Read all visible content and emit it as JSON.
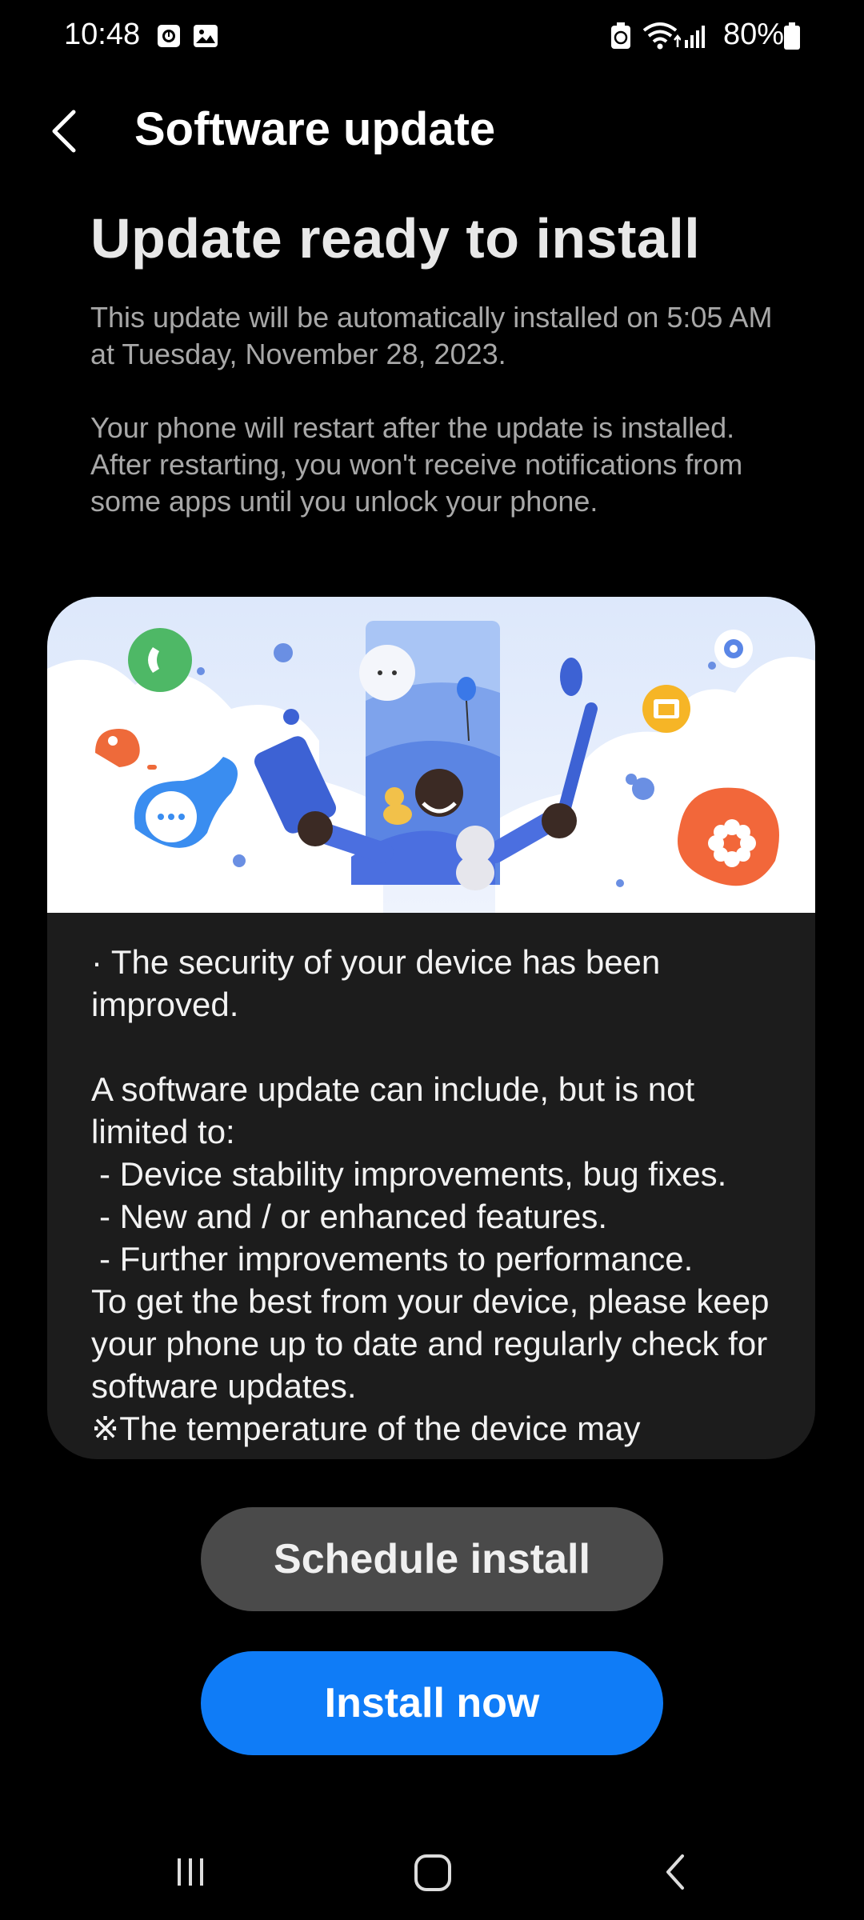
{
  "status_bar": {
    "time": "10:48",
    "battery_percent": "80%",
    "icons": [
      "screen-record-icon",
      "gallery-icon",
      "battery-saver-icon",
      "wifi-icon",
      "signal-icon",
      "battery-icon"
    ]
  },
  "header": {
    "title": "Software update",
    "back_icon": "chevron-left-icon"
  },
  "content": {
    "heading": "Update ready to install",
    "description_1": "This update will be automatically installed on 5:05 AM at Tuesday, November 28, 2023.",
    "description_2": "Your phone will restart after the update is installed. After restarting, you won't receive notifications from some apps until you unlock your phone."
  },
  "card": {
    "lines": [
      "· The security of your device has been improved.",
      "",
      "A software update can include, but is not limited to:",
      " - Device stability improvements, bug fixes.",
      " - New and / or enhanced features.",
      " - Further improvements to performance.",
      "To get the best from your device, please keep your phone up to date and regularly check for software updates.",
      "※The temperature of the device may"
    ]
  },
  "buttons": {
    "schedule": "Schedule install",
    "install": "Install now"
  },
  "navbar": {
    "recents": "recents-icon",
    "home": "home-icon",
    "back": "back-icon"
  },
  "colors": {
    "background": "#000000",
    "install_button": "#0f7cf7",
    "schedule_button": "#4a4a4a",
    "card_background": "#1c1c1c"
  }
}
